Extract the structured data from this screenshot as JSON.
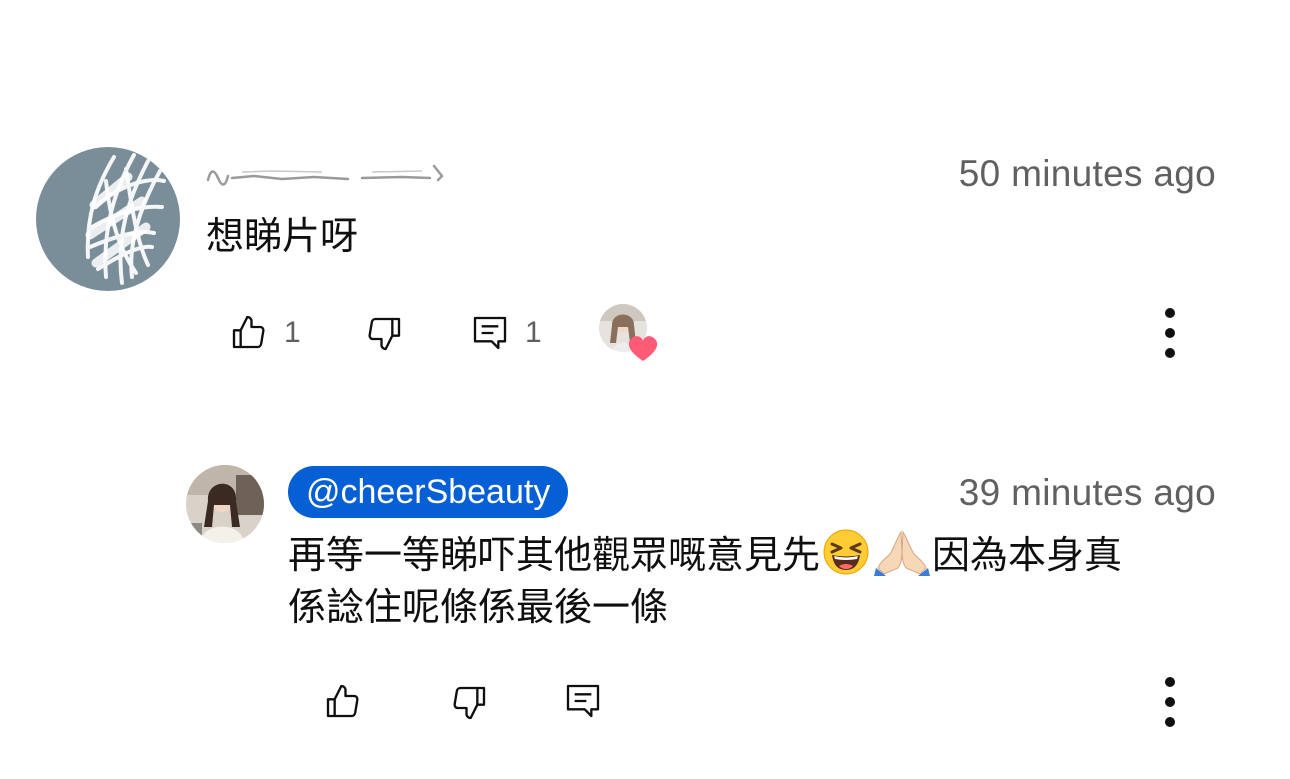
{
  "comment": {
    "author_hidden": true,
    "timestamp": "50 minutes ago",
    "text": "想睇片呀",
    "like_count": "1",
    "reply_count": "1",
    "creator_heart": true
  },
  "reply": {
    "author": "@cheerSbeauty",
    "timestamp": "39 minutes ago",
    "text_part1": "再等一等睇吓其他觀眾嘅意見先",
    "emoji1": "grinning-squinting-face",
    "emoji2": "folded-hands",
    "text_part2": "因為本身真",
    "text_line2": "係諗住呢條係最後一條"
  },
  "colors": {
    "badge": "#065fd4",
    "timestamp": "#606060",
    "heart": "#ff4e6e",
    "avatar": "#7a8e99"
  }
}
